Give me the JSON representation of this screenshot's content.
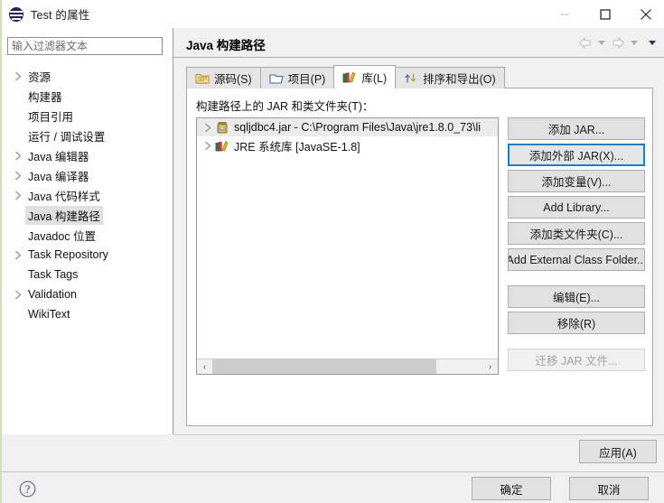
{
  "window": {
    "title": "Test 的属性",
    "icon": "eclipse-logo-icon",
    "minimize_label": "最小化",
    "maximize_label": "最大化",
    "close_label": "关闭"
  },
  "header": {
    "page_title": "Java 构建路径",
    "nav": {
      "back_label": "后退",
      "back_dropdown_label": "后退历史",
      "forward_label": "前进",
      "forward_dropdown_label": "前进历史",
      "menu_label": "查看菜单"
    }
  },
  "sidebar": {
    "filter": {
      "placeholder": "输入过滤器文本",
      "value": ""
    },
    "items": [
      {
        "label": "资源",
        "expandable": true,
        "selected": false
      },
      {
        "label": "构建器",
        "expandable": false,
        "selected": false
      },
      {
        "label": "项目引用",
        "expandable": false,
        "selected": false
      },
      {
        "label": "运行 / 调试设置",
        "expandable": false,
        "selected": false
      },
      {
        "label": "Java 编辑器",
        "expandable": true,
        "selected": false
      },
      {
        "label": "Java 编译器",
        "expandable": true,
        "selected": false
      },
      {
        "label": "Java 代码样式",
        "expandable": true,
        "selected": false
      },
      {
        "label": "Java 构建路径",
        "expandable": false,
        "selected": true
      },
      {
        "label": "Javadoc 位置",
        "expandable": false,
        "selected": false
      },
      {
        "label": "Task Repository",
        "expandable": true,
        "selected": false
      },
      {
        "label": "Task Tags",
        "expandable": false,
        "selected": false
      },
      {
        "label": "Validation",
        "expandable": true,
        "selected": false
      },
      {
        "label": "WikiText",
        "expandable": false,
        "selected": false
      }
    ]
  },
  "main": {
    "tabs": [
      {
        "label": "源码(S)",
        "icon": "source-folder-icon",
        "active": false
      },
      {
        "label": "项目(P)",
        "icon": "project-folder-icon",
        "active": false
      },
      {
        "label": "库(L)",
        "icon": "library-books-icon",
        "active": true
      },
      {
        "label": "排序和导出(O)",
        "icon": "order-export-arrows-icon",
        "active": false
      }
    ],
    "list_label": "构建路径上的 JAR 和类文件夹(T)：",
    "jar_entries": [
      {
        "label": "sqljdbc4.jar  -  C:\\Program Files\\Java\\jre1.8.0_73\\li",
        "icon": "jar-file-icon",
        "expandable": true,
        "highlighted": true
      },
      {
        "label": "JRE 系统库 [JavaSE-1.8]",
        "icon": "jre-library-icon",
        "expandable": true,
        "highlighted": false
      }
    ],
    "scrollbar": {
      "left_arrow": "‹",
      "right_arrow": "›",
      "thumb_percent": 83
    },
    "side_buttons": [
      {
        "label": "添加 JAR...",
        "state": "normal"
      },
      {
        "label": "添加外部 JAR(X)...",
        "state": "focused"
      },
      {
        "label": "添加变量(V)...",
        "state": "normal"
      },
      {
        "label": "Add Library...",
        "state": "normal"
      },
      {
        "label": "添加类文件夹(C)...",
        "state": "normal"
      },
      {
        "label": "Add External Class Folder...",
        "state": "normal"
      },
      {
        "label": "编辑(E)...",
        "state": "normal",
        "gap_before": true
      },
      {
        "label": "移除(R)",
        "state": "normal"
      },
      {
        "label": "迁移 JAR 文件...",
        "state": "disabled",
        "gap_before": true
      }
    ]
  },
  "footer": {
    "apply_label": "应用(A)",
    "help_label": "帮助",
    "ok_label": "确定",
    "cancel_label": "取消"
  },
  "colors": {
    "accent_focus": "#1a7ec8",
    "dialog_bg": "#f0f0f0",
    "panel_bg": "#ffffff",
    "selection": "#e0e0e0",
    "eclipse_purple": "#2b2054"
  }
}
